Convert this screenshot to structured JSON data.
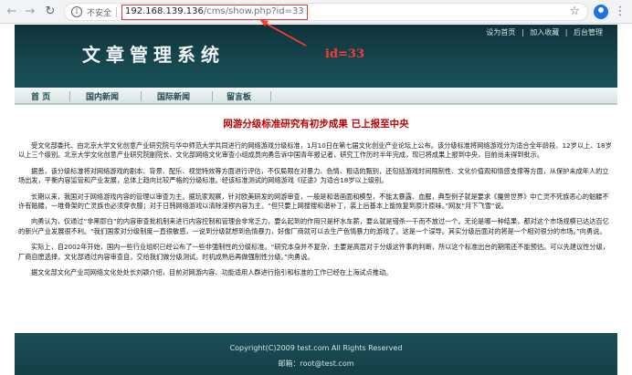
{
  "browser": {
    "insecure_label": "不安全",
    "url_host": "192.168.139.136",
    "url_path": "/cms/show.php?id=33"
  },
  "header": {
    "toplinks": [
      "设为首页",
      "|",
      "加入收藏",
      "|",
      "后台管理"
    ],
    "logo_text": "文章管理系统",
    "annotation": "id=33"
  },
  "nav": {
    "items": [
      "首 页",
      "国内新闻",
      "国际新闻",
      "留言板"
    ]
  },
  "article": {
    "title": "网游分级标准研究有初步成果 已上报至中央",
    "paragraphs": [
      "受文化部委托、由北京大学文化创意产业研究院与华中师范大学共同进行的网络游戏分级标准，1月10日在第七届文化创业产业论坛上公布。该分级标准将网络游戏分为适合全年龄段、12岁以上、18岁以上三个级别。北京大学文化创意产业研究院副院长、文化部网络文化审查小组成员向勇告诉中国青年报记者，研究工作历时半年完成，现已将成果上报到中央，目前尚未得到批示。",
      "据悉，该分级标准将对网络游戏的剧本、背景、配乐、视觉特效等方面进行评估，不仅局限在对暴力、色情、粗话的甄别，还包括游戏时间限制性、文化价值观和情感支撑等方面，从保护未成年人的立场出发，平衡内容监管和产业发展，总体上趋向比较严格的分级标准。经该标准测试的网络游戏《征途》为适合18岁以上级别。",
      "长期以来，我国对于网络游戏内容的管理以审查为主。据玩家观察，针对欧美研发的网游审查，一般是和谐画面和模型，不能太暴露、血腥，典型例子就是要求《魔兽世界》中亡灵不死族恶心的骷髅不许有骷髅，一堆骨架的亡灵族也必须穿衣服；对于日韩网络游戏以清除淫秽内容为主。“但只要上网搜搜和谐补丁，装上后基本上能恢复到原汁原味。”网友“月下飞雪”说。",
      "向勇认为，仅通过“非黑即白”的内容审查批机制来进行内容控制和管理会非常乏力，要么起到的作用只是杯水车薪，要么就是错杀一千而不放过一个。无论是哪一种结果，都对这个市场规模已达达百亿的新兴产业发展很不利。“我们国家对分级制度一直很敏感，一说到分级就想到色情暴力，好像厂商就可以去生产色情暴力的游戏了。这是一个误导。其实分级后面对的将是一个相对很分的市场。”向勇说。",
      "实际上，自2002年开始，国内一些行业组织已经公布了一些非强制性的分级标准。“研究本身并不复杂，主要是高层对于分级这件事的判断，所以这个标准出台的期限还不能预估。可以先建议性分级，厂商自愿选择，文化部通过内容审查自，交给我们做分级测试。时机成熟后再做强制性分级。”向勇说。",
      "据文化部文化产业司网络文化处处长刘颖介绍，目前对网游内容、功能适用人群进行指引和标准的工作已经在上海试点推动。"
    ]
  },
  "footer": {
    "copyright": "Copyright(C)2009 test.com All Rights Reserved",
    "email": "邮箱：root@test.com"
  },
  "colors": {
    "header_bg": "#174850",
    "title_red": "#c00000",
    "annotation_red": "#ff3b30"
  }
}
